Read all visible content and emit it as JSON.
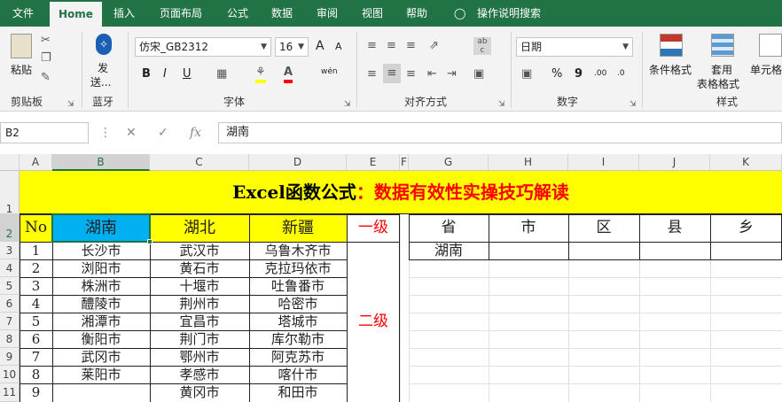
{
  "menu": {
    "file": "文件",
    "home": "Home",
    "insert": "插入",
    "page_layout": "页面布局",
    "formulas": "公式",
    "data": "数据",
    "review": "审阅",
    "view": "视图",
    "help": "帮助",
    "tell_me": "操作说明搜索"
  },
  "ribbon": {
    "clipboard": {
      "paste": "粘贴",
      "label": "剪贴板"
    },
    "bluetooth": {
      "send": "发",
      "send2": "送...",
      "label": "蓝牙"
    },
    "font": {
      "name": "仿宋_GB2312",
      "size": "16",
      "bold": "B",
      "italic": "I",
      "underline": "U",
      "grow": "A",
      "shrink": "A",
      "phonetic": "wén",
      "label": "字体"
    },
    "alignment": {
      "label": "对齐方式"
    },
    "number": {
      "format": "日期",
      "percent": "%",
      "comma": "9",
      "dec_inc": ".00",
      "dec_dec": ".0",
      "label": "数字"
    },
    "styles": {
      "conditional": "条件格式",
      "table1": "套用",
      "table2": "表格格式",
      "cell_styles": "单元格",
      "label": "样式"
    },
    "accent_color": "#217346"
  },
  "formula_bar": {
    "name_box": "B2",
    "fx": "fx",
    "content": "湖南"
  },
  "columns": [
    "A",
    "B",
    "C",
    "D",
    "E",
    "F",
    "G",
    "H",
    "I",
    "J",
    "K"
  ],
  "rows": [
    "1",
    "2",
    "3",
    "4",
    "5",
    "6",
    "7",
    "8",
    "9",
    "10",
    "11"
  ],
  "sheet": {
    "title_black": "Excel函数公式",
    "title_red": "：数据有效性实操技巧解读",
    "headers": {
      "no": "No",
      "b": "湖南",
      "c": "湖北",
      "d": "新疆",
      "e": "一级",
      "level2": "二级"
    },
    "right_headers": [
      "省",
      "市",
      "区",
      "县",
      "乡"
    ],
    "right_value": "湖南",
    "data_rows": [
      {
        "no": "1",
        "b": "长沙市",
        "c": "武汉市",
        "d": "乌鲁木齐市"
      },
      {
        "no": "2",
        "b": "浏阳市",
        "c": "黄石市",
        "d": "克拉玛依市"
      },
      {
        "no": "3",
        "b": "株洲市",
        "c": "十堰市",
        "d": "吐鲁番市"
      },
      {
        "no": "4",
        "b": "醴陵市",
        "c": "荆州市",
        "d": "哈密市"
      },
      {
        "no": "5",
        "b": "湘潭市",
        "c": "宜昌市",
        "d": "塔城市"
      },
      {
        "no": "6",
        "b": "衡阳市",
        "c": "荆门市",
        "d": "库尔勒市"
      },
      {
        "no": "7",
        "b": "武冈市",
        "c": "鄂州市",
        "d": "阿克苏市"
      },
      {
        "no": "8",
        "b": "莱阳市",
        "c": "孝感市",
        "d": "喀什市"
      },
      {
        "no": "9",
        "b": "",
        "c": "黄冈市",
        "d": "和田市"
      }
    ]
  }
}
